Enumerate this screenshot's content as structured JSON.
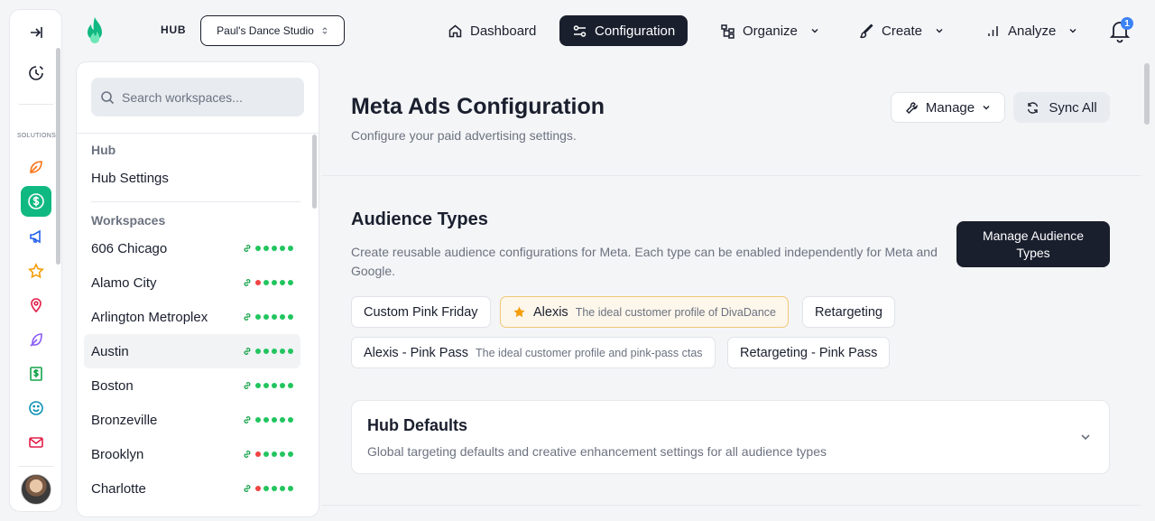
{
  "header": {
    "hub_label": "HUB",
    "studio_select": "Paul's Dance Studio",
    "nav": [
      {
        "label": "Dashboard",
        "icon": "home-icon"
      },
      {
        "label": "Configuration",
        "icon": "sliders-icon"
      },
      {
        "label": "Organize",
        "icon": "hierarchy-icon"
      },
      {
        "label": "Create",
        "icon": "brush-icon"
      },
      {
        "label": "Analyze",
        "icon": "bar-chart-icon"
      }
    ],
    "notification_count": "1"
  },
  "rail": {
    "solutions_label": "SOLUTIONS",
    "icons": [
      "collapse-icon",
      "clock-icon",
      "leaf-icon",
      "dollar-icon",
      "megaphone-icon",
      "star-icon",
      "location-icon",
      "feather-icon",
      "money-icon",
      "smile-icon",
      "mail-icon"
    ]
  },
  "workspace_panel": {
    "search_placeholder": "Search workspaces...",
    "hub_section": "Hub",
    "hub_settings": "Hub Settings",
    "workspaces_section": "Workspaces",
    "workspaces": [
      {
        "name": "606 Chicago",
        "statuses": [
          "green",
          "green",
          "green",
          "green",
          "green"
        ]
      },
      {
        "name": "Alamo City",
        "statuses": [
          "red",
          "green",
          "green",
          "green",
          "green"
        ]
      },
      {
        "name": "Arlington Metroplex",
        "statuses": [
          "green",
          "green",
          "green",
          "green",
          "green"
        ]
      },
      {
        "name": "Austin",
        "statuses": [
          "green",
          "green",
          "green",
          "green",
          "green"
        ]
      },
      {
        "name": "Boston",
        "statuses": [
          "green",
          "green",
          "green",
          "green",
          "green"
        ]
      },
      {
        "name": "Bronzeville",
        "statuses": [
          "green",
          "green",
          "green",
          "green",
          "green"
        ]
      },
      {
        "name": "Brooklyn",
        "statuses": [
          "red",
          "green",
          "green",
          "green",
          "green"
        ]
      },
      {
        "name": "Charlotte",
        "statuses": [
          "red",
          "green",
          "green",
          "green",
          "green"
        ]
      }
    ]
  },
  "main": {
    "title": "Meta Ads Configuration",
    "subtitle": "Configure your paid advertising settings.",
    "manage_label": "Manage",
    "sync_label": "Sync All",
    "audience_types": {
      "title": "Audience Types",
      "description": "Create reusable audience configurations for Meta. Each type can be enabled independently for Meta and Google.",
      "manage_button": "Manage Audience Types",
      "chips": [
        {
          "label": "Custom Pink Friday",
          "desc": ""
        },
        {
          "label": "Alexis",
          "desc": "The ideal customer profile of DivaDance"
        },
        {
          "label": "Retargeting",
          "desc": ""
        },
        {
          "label": "Alexis - Pink Pass",
          "desc": "The ideal customer profile and pink-pass ctas"
        },
        {
          "label": "Retargeting - Pink Pass",
          "desc": ""
        }
      ]
    },
    "hub_defaults": {
      "title": "Hub Defaults",
      "description": "Global targeting defaults and creative enhancement settings for all audience types"
    }
  },
  "colors": {
    "accent_dark": "#1a1f2e",
    "brand_green": "#10b981",
    "status_green": "#22c55e",
    "status_red": "#ef4444",
    "badge_blue": "#3b82f6"
  }
}
